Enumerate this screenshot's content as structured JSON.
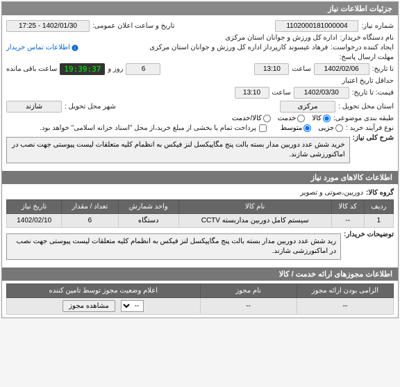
{
  "panel1": {
    "title": "جزئیات اطلاعات نیاز",
    "need_number_label": "شماره نیاز:",
    "need_number": "1102000181000004",
    "announce_date_label": "تاریخ و ساعت اعلان عمومی:",
    "announce_date": "1402/01/30 - 17:25",
    "buyer_label": "نام دستگاه خریدار:",
    "buyer": "اداره کل ورزش و جوانان استان مرکزی",
    "requester_label": "ایجاد کننده درخواست:",
    "requester": "فرهاد عیسوند کارپرداز اداره کل ورزش و جوانان استان مرکزی",
    "contact_label": "اطلاعات تماس خریدار",
    "send_deadline_label": "مهلت ارسال پاسخ:",
    "send_deadline_until_label": "تا تاریخ:",
    "send_date": "1402/02/06",
    "send_time_label": "ساعت",
    "send_time": "13:10",
    "days_label": "روز و",
    "days": "6",
    "remaining_label": "ساعت باقی مانده",
    "timer": "19:39:37",
    "validity_label": "حداقل تاریخ اعتبار",
    "validity_until_label": "قیمت: تا تاریخ:",
    "validity_date": "1402/03/30",
    "validity_time_label": "ساعت",
    "validity_time": "13:10",
    "province_label": "استان محل تحویل :",
    "province": "مرکزی",
    "city_label": "شهر محل تحویل :",
    "city": "شازند",
    "classification_label": "طبقه بندی موضوعی:",
    "class_opts": [
      "کالا",
      "خدمت",
      "کالا/خدمت"
    ],
    "purchase_type_label": "نوع فرآیند خرید :",
    "purchase_opts": [
      "جزیی",
      "متوسط"
    ],
    "payment_note": "پرداخت تمام یا بخشی از مبلغ خرید،از محل \"اسناد خزانه اسلامی\" خواهد بود.",
    "summary_label": "شرح کلی نیاز:",
    "summary": "خرید شش عدد دوربین مدار بسته بالت پنج مگاپیکسل لنز فیکس به انظمام کلیه متعلقات لیست پیوستی جهت نصب در اماکنورزشی شازند."
  },
  "panel2": {
    "title": "اطلاعات کالاهای مورد نیاز",
    "group_label": "گروه کالا:",
    "group": "دوربین،صوتی و تصویر",
    "headers": [
      "ردیف",
      "کد کالا",
      "نام کالا",
      "واحد شمارش",
      "تعداد / مقدار",
      "تاریخ نیاز"
    ],
    "rows": [
      {
        "idx": "1",
        "code": "--",
        "name": "سیستم کامل دوربین مداربسته CCTV",
        "unit": "دستگاه",
        "qty": "6",
        "date": "1402/02/10"
      }
    ],
    "buyer_note_label": "توضیحات خریدار:",
    "buyer_note": "رید شش عدد دوربین مدار بسته بالت پنج مگاپیکسل لنز فیکس به انظمام کلیه متعلقات لیست پیوستی جهت نصب در اماکنورزشی شازند."
  },
  "panel3": {
    "title": "اطلاعات مجوزهای ارائه خدمت / کالا",
    "headers": [
      "الزامی بودن ارائه مجوز",
      "نام مجوز",
      "اعلام وضعیت مجوز توسط تامین کننده"
    ],
    "row": {
      "mandatory": "--",
      "name": "--",
      "select_placeholder": "--",
      "view_btn": "مشاهده مجوز"
    }
  }
}
